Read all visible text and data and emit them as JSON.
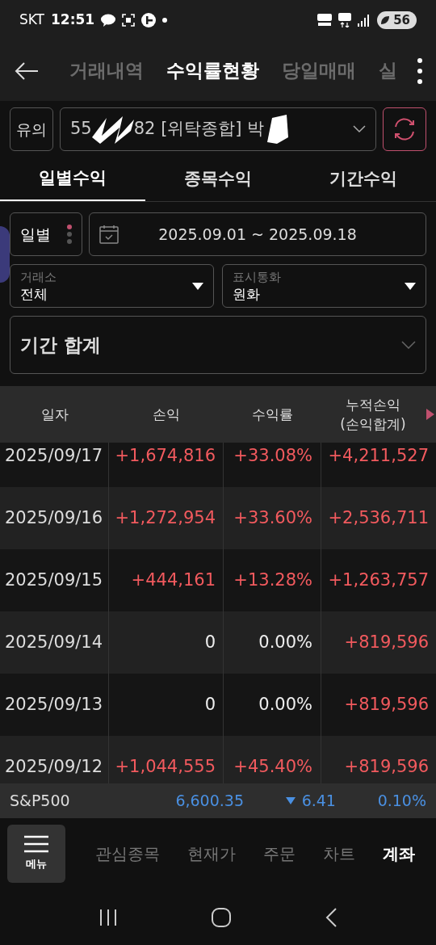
{
  "status_bar": {
    "carrier": "SKT",
    "time": "12:51",
    "battery": "56"
  },
  "header": {
    "tabs": [
      {
        "label": "거래내역",
        "selected": false
      },
      {
        "label": "수익률현황",
        "selected": true
      },
      {
        "label": "당일매매",
        "selected": false
      },
      {
        "label": "실",
        "selected": false
      }
    ]
  },
  "account": {
    "type_button": "유의",
    "number_start": "55",
    "number_rest": "82 [위탁종합] 박"
  },
  "sub_tabs": [
    {
      "label": "일별수익",
      "selected": true
    },
    {
      "label": "종목수익",
      "selected": false
    },
    {
      "label": "기간수익",
      "selected": false
    }
  ],
  "filters": {
    "period_button": "일별",
    "date_range": "2025.09.01 ~ 2025.09.18",
    "exchange": {
      "label": "거래소",
      "value": "전체"
    },
    "currency": {
      "label": "표시통화",
      "value": "원화"
    },
    "summary": "기간 합계"
  },
  "table": {
    "columns": [
      "일자",
      "손익",
      "수익률",
      "누적손익\n(손익합계)"
    ],
    "rows": [
      {
        "date": "2025/09/17",
        "profit": "+1,674,816",
        "rate": "+33.08%",
        "cumulative": "+4,211,527",
        "positive": true
      },
      {
        "date": "2025/09/16",
        "profit": "+1,272,954",
        "rate": "+33.60%",
        "cumulative": "+2,536,711",
        "positive": true
      },
      {
        "date": "2025/09/15",
        "profit": "+444,161",
        "rate": "+13.28%",
        "cumulative": "+1,263,757",
        "positive": true
      },
      {
        "date": "2025/09/14",
        "profit": "0",
        "rate": "0.00%",
        "cumulative": "+819,596",
        "positive": false
      },
      {
        "date": "2025/09/13",
        "profit": "0",
        "rate": "0.00%",
        "cumulative": "+819,596",
        "positive": false
      },
      {
        "date": "2025/09/12",
        "profit": "+1,044,555",
        "rate": "+45.40%",
        "cumulative": "+819,596",
        "positive": true
      }
    ]
  },
  "ticker": {
    "name": "S&P500",
    "price": "6,600.35",
    "change": "6.41",
    "rate": "0.10%"
  },
  "bottom_nav": {
    "menu": "메뉴",
    "items": [
      {
        "label": "관심종목",
        "selected": false
      },
      {
        "label": "현재가",
        "selected": false
      },
      {
        "label": "주문",
        "selected": false
      },
      {
        "label": "차트",
        "selected": false
      },
      {
        "label": "계좌",
        "selected": true
      }
    ]
  }
}
